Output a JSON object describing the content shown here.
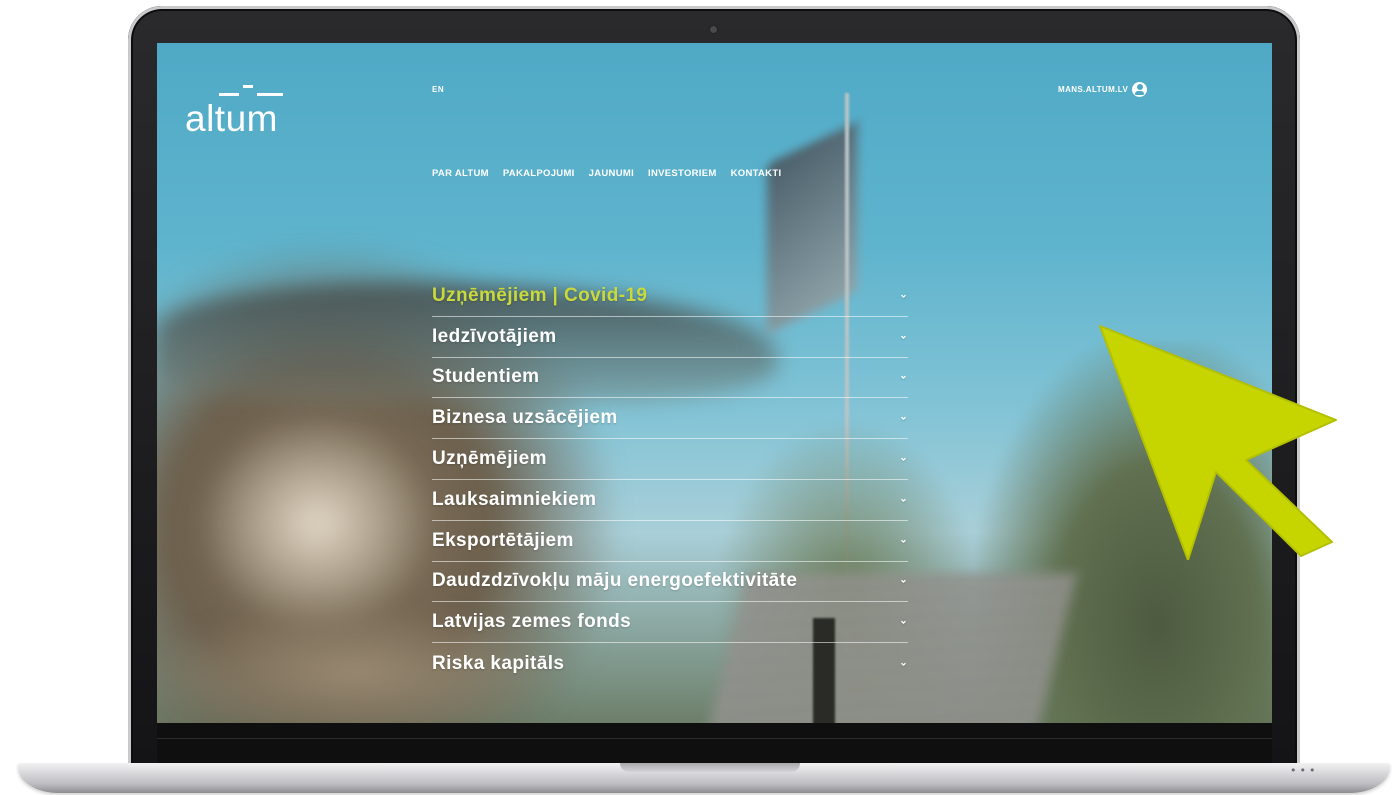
{
  "site": {
    "logo_text": "altum",
    "language_link": "EN",
    "account_link": "MANS.ALTUM.LV",
    "account_icon": "user-circle-icon"
  },
  "top_nav": {
    "items": [
      "PAR ALTUM",
      "PAKALPOJUMI",
      "JAUNUMI",
      "INVESTORIEM",
      "KONTAKTI"
    ]
  },
  "menu": {
    "items": [
      {
        "label": "Uzņēmējiem | Covid-19",
        "active": true
      },
      {
        "label": "Iedzīvotājiem",
        "active": false
      },
      {
        "label": "Studentiem",
        "active": false
      },
      {
        "label": "Biznesa uzsācējiem",
        "active": false
      },
      {
        "label": "Uzņēmējiem",
        "active": false
      },
      {
        "label": "Lauksaimniekiem",
        "active": false
      },
      {
        "label": "Eksportētājiem",
        "active": false
      },
      {
        "label": "Daudzdzīvokļu māju energoefektivitāte",
        "active": false
      },
      {
        "label": "Latvijas zemes fonds",
        "active": false
      },
      {
        "label": "Riska kapitāls",
        "active": false
      }
    ],
    "chevron_glyph": "⌄"
  },
  "colors": {
    "accent": "#c9d93b",
    "cursor": "#c6d400",
    "sky": "#4fa9c6"
  }
}
